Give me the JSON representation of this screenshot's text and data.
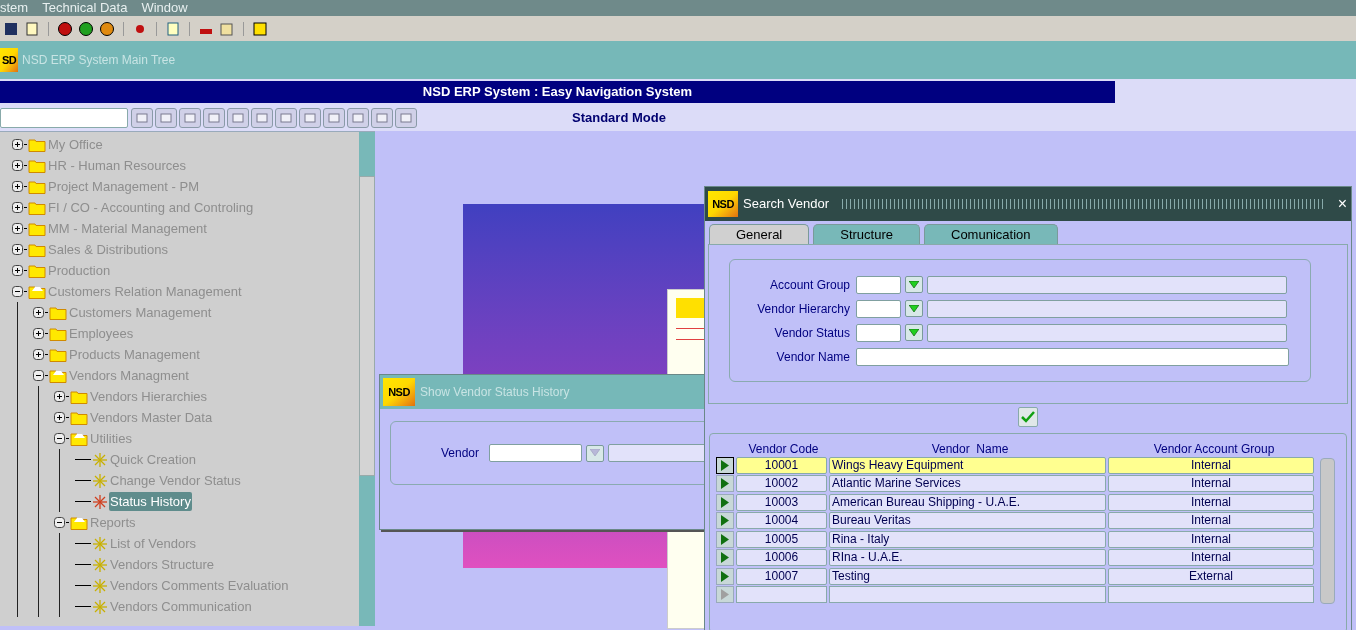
{
  "menu_bar": {
    "items": [
      {
        "label": "stem"
      },
      {
        "label": "Technical Data"
      },
      {
        "label": "Window"
      }
    ]
  },
  "main_tree_window": {
    "logo": "SD",
    "title": "NSD ERP System Main Tree"
  },
  "banner": {
    "title": "NSD ERP System : Easy Navigation System"
  },
  "mode_bar": {
    "mode": "Standard Mode"
  },
  "tree": [
    {
      "label": "My Office",
      "kind": "folder",
      "expanded": false,
      "selected": false
    },
    {
      "label": "HR - Human Resources",
      "kind": "folder",
      "expanded": false,
      "selected": false
    },
    {
      "label": "Project Management - PM",
      "kind": "folder",
      "expanded": false,
      "selected": false
    },
    {
      "label": "FI / CO - Accounting and Controling",
      "kind": "folder",
      "expanded": false,
      "selected": false
    },
    {
      "label": "MM - Material Management",
      "kind": "folder",
      "expanded": false,
      "selected": false
    },
    {
      "label": "Sales & Distributions",
      "kind": "folder",
      "expanded": false,
      "selected": false
    },
    {
      "label": "Production",
      "kind": "folder",
      "expanded": false,
      "selected": false
    },
    {
      "label": "Customers Relation Management",
      "kind": "folder",
      "expanded": true,
      "selected": false,
      "children": [
        {
          "label": "Customers Management",
          "kind": "folder",
          "expanded": false,
          "selected": false
        },
        {
          "label": "Employees",
          "kind": "folder",
          "expanded": false,
          "selected": false
        },
        {
          "label": "Products Management",
          "kind": "folder",
          "expanded": false,
          "selected": false
        },
        {
          "label": "Vendors Managment",
          "kind": "folder",
          "expanded": true,
          "selected": false,
          "children": [
            {
              "label": "Vendors Hierarchies",
              "kind": "folder",
              "expanded": false,
              "selected": false
            },
            {
              "label": "Vendors Master Data",
              "kind": "folder",
              "expanded": false,
              "selected": false
            },
            {
              "label": "Utilities",
              "kind": "folder",
              "expanded": true,
              "selected": false,
              "children": [
                {
                  "label": "Quick Creation",
                  "kind": "leaf",
                  "selected": false
                },
                {
                  "label": "Change Vendor Status",
                  "kind": "leaf",
                  "selected": false
                },
                {
                  "label": "Status History",
                  "kind": "leaf",
                  "selected": true
                }
              ]
            },
            {
              "label": "Reports",
              "kind": "folder",
              "expanded": true,
              "selected": false,
              "children": [
                {
                  "label": "List of Vendors",
                  "kind": "leaf",
                  "selected": false
                },
                {
                  "label": "Vendors Structure",
                  "kind": "leaf",
                  "selected": false
                },
                {
                  "label": "Vendors Comments Evaluation",
                  "kind": "leaf",
                  "selected": false
                },
                {
                  "label": "Vendors Communication",
                  "kind": "leaf",
                  "selected": false
                }
              ]
            }
          ]
        }
      ]
    }
  ],
  "status_history_window": {
    "logo": "NSD",
    "title": "Show Vendor Status History",
    "fields": [
      {
        "label": "Vendor"
      }
    ]
  },
  "search_vendor_window": {
    "logo": "NSD",
    "title": "Search Vendor",
    "close": "×",
    "tabs": [
      {
        "label": "General",
        "selected": true
      },
      {
        "label": "Structure",
        "selected": false
      },
      {
        "label": "Comunication",
        "selected": false
      }
    ],
    "fields": [
      {
        "label": "Account Group",
        "kind": "lookup"
      },
      {
        "label": "Vendor Hierarchy",
        "kind": "lookup"
      },
      {
        "label": "Vendor Status",
        "kind": "lookup"
      },
      {
        "label": "Vendor Name",
        "kind": "text"
      }
    ],
    "table": {
      "columns": [
        "Vendor Code",
        "Vendor  Name",
        "Vendor Account Group"
      ],
      "rows": [
        {
          "code": "10001",
          "name": "Wings Heavy Equipment",
          "group": "Internal",
          "selected": true
        },
        {
          "code": "10002",
          "name": "Atlantic Marine Services",
          "group": "Internal",
          "selected": false
        },
        {
          "code": "10003",
          "name": "American Bureau Shipping - U.A.E.",
          "group": "Internal",
          "selected": false
        },
        {
          "code": "10004",
          "name": "Bureau Veritas",
          "group": "Internal",
          "selected": false
        },
        {
          "code": "10005",
          "name": "Rina - Italy",
          "group": "Internal",
          "selected": false
        },
        {
          "code": "10006",
          "name": "RIna - U.A.E.",
          "group": "Internal",
          "selected": false
        },
        {
          "code": "10007",
          "name": "Testing",
          "group": "External",
          "selected": false
        }
      ]
    }
  }
}
